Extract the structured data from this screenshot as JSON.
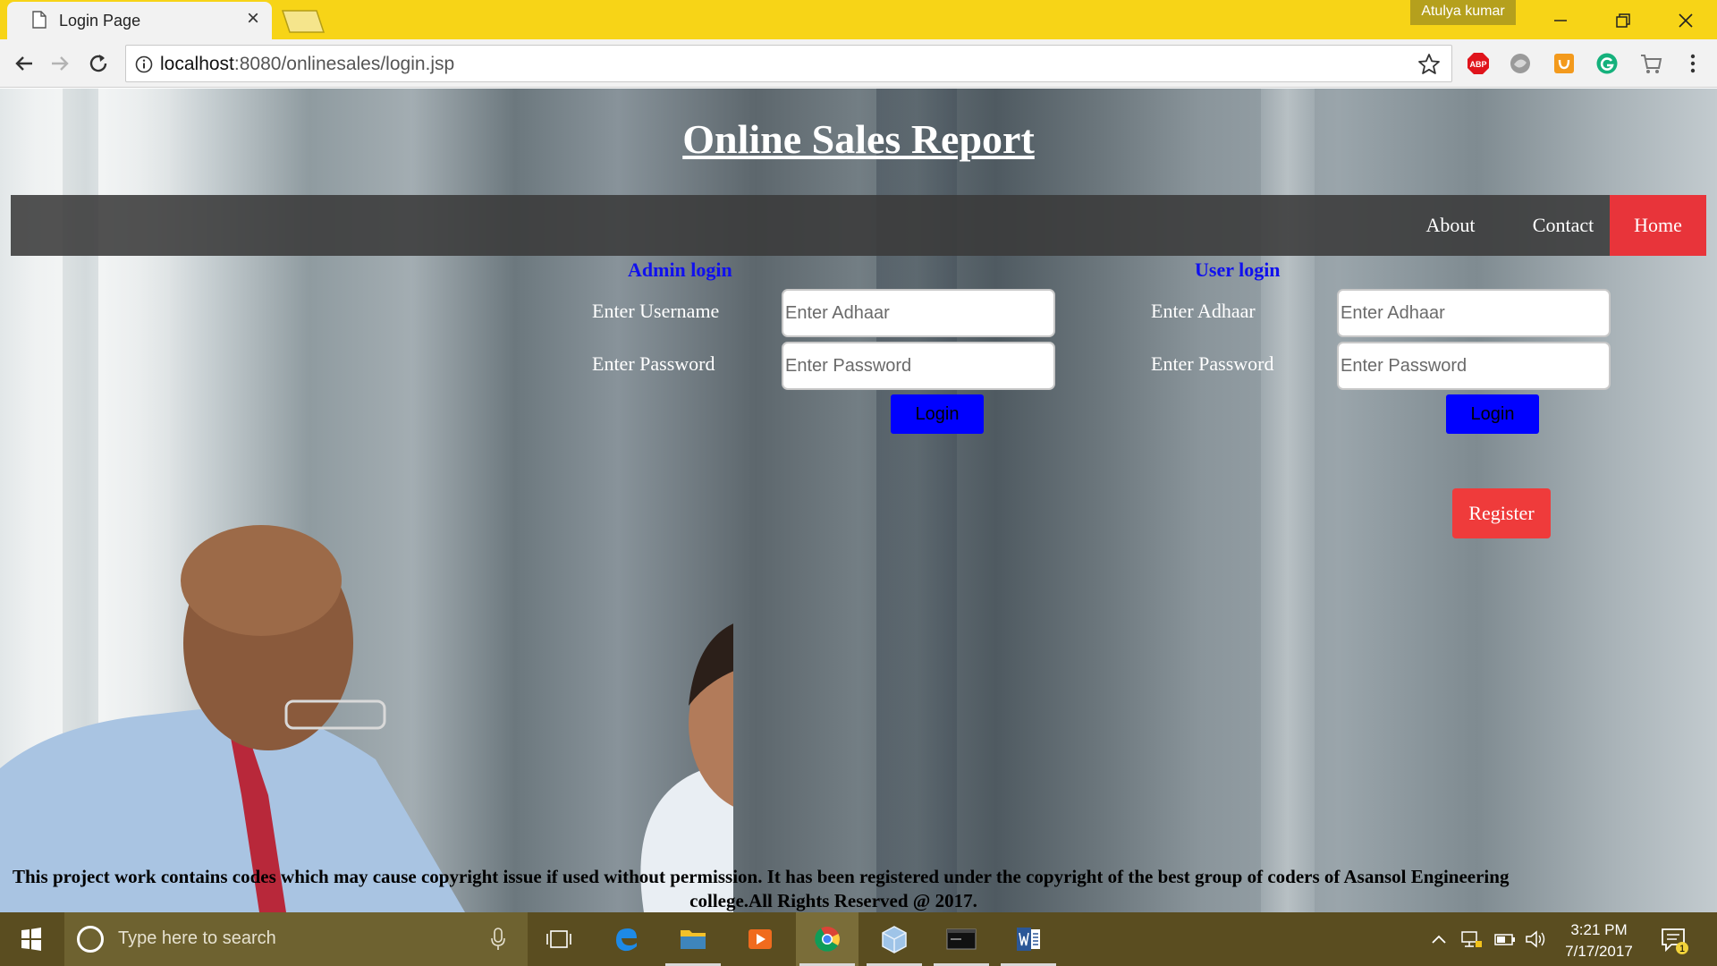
{
  "browser": {
    "tab_title": "Login Page",
    "tab_close": "×",
    "profile_name": "Atulya kumar",
    "url_host": "localhost",
    "url_rest": ":8080/onlinesales/login.jsp",
    "extensions": [
      "adblock-plus-icon",
      "shield-extension-icon",
      "honey-extension-icon",
      "grammarly-icon",
      "shopping-cart-icon"
    ],
    "abp_label": "ABP"
  },
  "page": {
    "title": "Online Sales Report",
    "nav": {
      "about": "About",
      "contact": "Contact",
      "home": "Home"
    },
    "admin": {
      "heading": "Admin login",
      "username_label": "Enter Username",
      "password_label": "Enter Password",
      "username_placeholder": "Enter Adhaar",
      "password_placeholder": "Enter Password",
      "login_label": "Login"
    },
    "user": {
      "heading": "User login",
      "adhaar_label": "Enter Adhaar",
      "password_label": "Enter Password",
      "adhaar_placeholder": "Enter Adhaar",
      "password_placeholder": "Enter Password",
      "login_label": "Login"
    },
    "register_label": "Register",
    "footer_line1": "This project work contains codes which may cause copyright issue if used without permission. It has been registered under the copyright of the best group of coders of Asansol Engineering",
    "footer_line2": "college.All Rights Reserved @ 2017."
  },
  "taskbar": {
    "search_placeholder": "Type here to search",
    "time": "3:21 PM",
    "date": "7/17/2017",
    "notification_count": "1",
    "colors": {
      "taskbar": "#5a4d20",
      "titlebar": "#f7d417",
      "accent_red": "#e8343a",
      "login_blue": "#0000ff"
    }
  }
}
